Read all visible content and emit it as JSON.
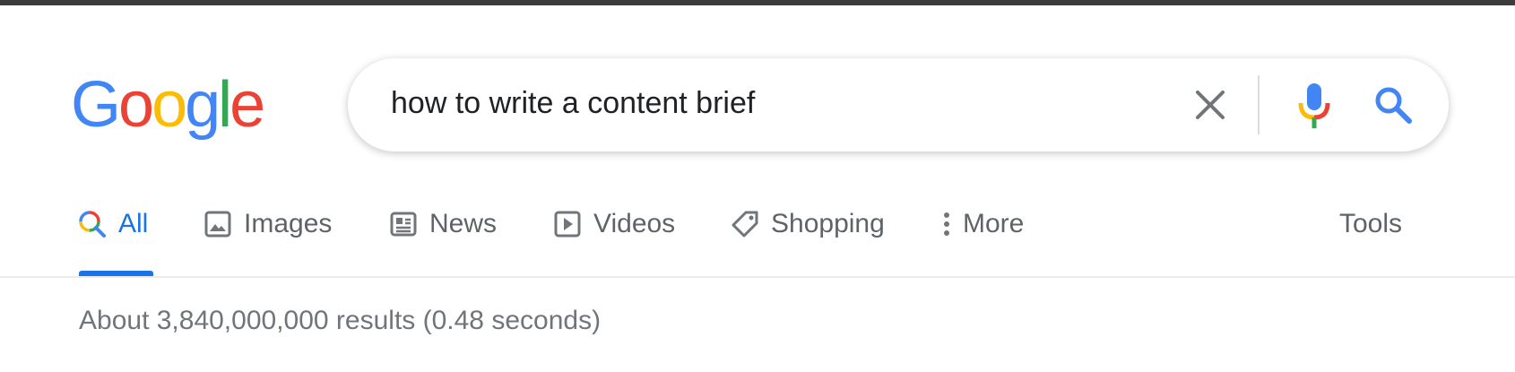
{
  "logo": {
    "letters": [
      "G",
      "o",
      "o",
      "g",
      "l",
      "e"
    ],
    "colors": [
      "#4285F4",
      "#EA4335",
      "#FBBC05",
      "#4285F4",
      "#34A853",
      "#EA4335"
    ]
  },
  "search": {
    "query": "how to write a content brief",
    "clear_icon": "close-icon",
    "mic_icon": "microphone-icon",
    "search_icon": "search-icon"
  },
  "tabs": [
    {
      "label": "All",
      "icon": "search-multicolor-icon",
      "active": true
    },
    {
      "label": "Images",
      "icon": "image-icon",
      "active": false
    },
    {
      "label": "News",
      "icon": "newspaper-icon",
      "active": false
    },
    {
      "label": "Videos",
      "icon": "play-icon",
      "active": false
    },
    {
      "label": "Shopping",
      "icon": "tag-icon",
      "active": false
    },
    {
      "label": "More",
      "icon": "more-vert-icon",
      "active": false
    }
  ],
  "tools_label": "Tools",
  "result_stats": "About 3,840,000,000 results (0.48 seconds)",
  "colors": {
    "accent": "#1a73e8",
    "tab_text": "#5f6368",
    "stats_text": "#70757a"
  }
}
